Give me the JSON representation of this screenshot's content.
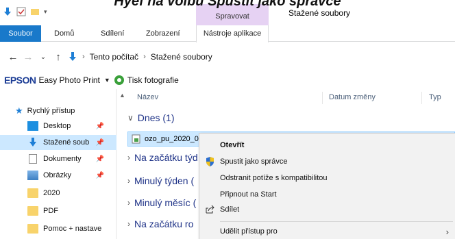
{
  "caption": "Hyef na volbu Spustit jako správce",
  "window": {
    "title": "Stažené soubory"
  },
  "ribbon": {
    "context_group": "Spravovat",
    "tabs": [
      {
        "label": "Soubor"
      },
      {
        "label": "Domů"
      },
      {
        "label": "Sdílení"
      },
      {
        "label": "Zobrazení"
      },
      {
        "label": "Nástroje aplikace"
      }
    ]
  },
  "address": {
    "crumbs": [
      "Tento počítač",
      "Stažené soubory"
    ]
  },
  "epson": {
    "logo": "EPSON",
    "app": "Easy Photo Print",
    "tisk": "Tisk fotografie"
  },
  "nav": {
    "quick_access": "Rychlý přístup",
    "items": [
      {
        "label": "Desktop",
        "icon": "desktop-icon",
        "pinned": true
      },
      {
        "label": "Stažené soub",
        "icon": "download-icon",
        "pinned": true
      },
      {
        "label": "Dokumenty",
        "icon": "document-icon",
        "pinned": true
      },
      {
        "label": "Obrázky",
        "icon": "pictures-icon",
        "pinned": true
      },
      {
        "label": "2020",
        "icon": "folder-icon",
        "pinned": false
      },
      {
        "label": "PDF",
        "icon": "folder-icon",
        "pinned": false
      },
      {
        "label": "Pomoc + nastave",
        "icon": "folder-icon",
        "pinned": false
      }
    ]
  },
  "columns": [
    "Název",
    "Datum změny",
    "Typ"
  ],
  "groups": [
    {
      "label": "Dnes (1)",
      "expanded": true
    },
    {
      "label": "Na začátku týd",
      "expanded": false
    },
    {
      "label": "Minulý týden (",
      "expanded": false
    },
    {
      "label": "Minulý měsíc (",
      "expanded": false
    },
    {
      "label": "Na začátku ro",
      "expanded": false
    }
  ],
  "file": {
    "name": "ozo_pu_2020_0"
  },
  "context_menu": {
    "items": [
      {
        "label": "Otevřít",
        "bold": true
      },
      {
        "label": "Spustit jako správce",
        "icon": "uac-shield-icon"
      },
      {
        "label": "Odstranit potíže s kompatibilitou"
      },
      {
        "label": "Připnout na Start"
      },
      {
        "label": "Sdílet",
        "icon": "share-icon"
      },
      {
        "label": "Udělit přístup pro",
        "submenu": true
      }
    ]
  },
  "colors": {
    "file_tab": "#1979ca",
    "context_group": "#e6d2f3",
    "selection": "#cce8ff",
    "group_text": "#1e3287"
  }
}
